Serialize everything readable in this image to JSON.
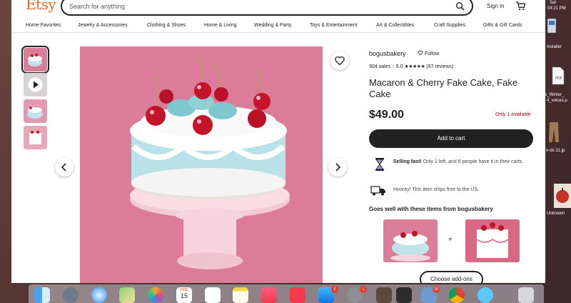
{
  "header": {
    "logo": "Etsy",
    "search_placeholder": "Search for anything",
    "signin": "Sign in"
  },
  "categories": [
    "Home Favorites",
    "Jewelry & Accessories",
    "Clothing & Shoes",
    "Home & Living",
    "Wedding & Party",
    "Toys & Entertainment",
    "Art & Collectibles",
    "Craft Supplies",
    "Gifts & Gift Cards"
  ],
  "listing": {
    "shop_name": "bogusbakery",
    "follow_label": "Follow",
    "sales": "304 sales",
    "rating": "5.0",
    "stars": "★★★★★",
    "reviews": "(97 reviews)",
    "title": "Macaron & Cherry Fake Cake, Fake Cake",
    "price": "$49.00",
    "availability": "Only 1 available",
    "add_to_cart": "Add to cart",
    "selling_fast_bold": "Selling fast!",
    "selling_fast_text": " Only 1 left, and 6 people have it in their carts.",
    "shipping_text": "Hooray! This item ships free to the US.",
    "goes_well": "Goes well with these items from bogusbakery",
    "plus": "+",
    "choose_addons": "Choose add-ons"
  },
  "desktop": {
    "clock_day": "Sat",
    "clock_time": "04:21 PM",
    "installer_label": "Installer",
    "file1": "e_Winter_",
    "file1b": "4_voices.p",
    "file2": "n-dc-11.jp",
    "file3": "Unknown"
  },
  "dock": {
    "calendar_month": "FEB",
    "calendar_day": "15",
    "badge_appstore": "6",
    "badge_settings": "1",
    "badge_photos": "39"
  },
  "colors": {
    "accent": "#f1641e",
    "button_dark": "#222222",
    "availability": "#b3001b",
    "photo_bg": "#db7d98"
  }
}
